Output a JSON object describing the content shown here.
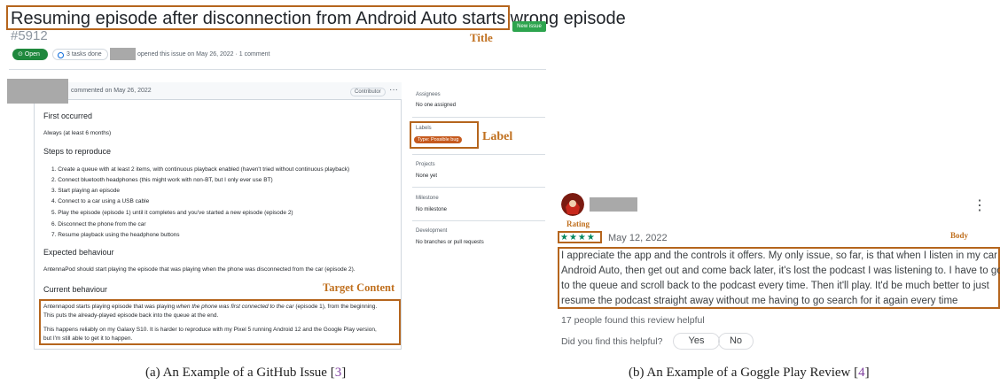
{
  "annotations": {
    "title": "Title",
    "label": "Label",
    "target_content": "Target Content",
    "rating": "Rating",
    "body": "Body"
  },
  "github": {
    "title": "Resuming episode after disconnection from Android Auto starts wrong episode",
    "new_issue": "New issue",
    "issue_number": "#5912",
    "status": "Open",
    "tasks": "3 tasks done",
    "opened_text": "opened this issue on May 26, 2022 · 1 comment",
    "comment": {
      "header_text": "commented on May 26, 2022",
      "role": "Contributor",
      "more": "···",
      "sections": [
        {
          "heading": "First occurred",
          "text": "Always (at least 6 months)"
        },
        {
          "heading": "Steps to reproduce"
        },
        {
          "heading": "Expected behaviour",
          "text": "AntennaPod should start playing the episode that was playing when the phone was disconnected from the car (episode 2)."
        },
        {
          "heading": "Current behaviour"
        }
      ],
      "steps": [
        "1. Create a queue with at least 2 items, with continuous playback enabled (haven't tried without continuous playback)",
        "2. Connect bluetooth headphones (this might work with non-BT, but I only ever use BT)",
        "3. Start playing an episode",
        "4. Connect to a car using a USB cable",
        "5. Play the episode (episode 1) until it completes and you've started a new episode (episode 2)",
        "6. Disconnect the phone from the car",
        "7. Resume playback using the headphone buttons"
      ],
      "current_p1_a": "Antennapod starts playing episode that was playing ",
      "current_p1_em": "when the phone was first connected to the car",
      "current_p1_b": " (episode 1), from the beginning.",
      "current_p1_c": "This puts the already-played episode back into the queue at the end.",
      "current_p2_a": "This happens reliably on my Galaxy S10. It is harder to reproduce with my Pixel 5 running Android 12 and the Google Play version,",
      "current_p2_b": "but I'm still able to get it to happen."
    },
    "sidebar": {
      "assignees_label": "Assignees",
      "assignees_value": "No one assigned",
      "labels_label": "Labels",
      "label_pill": "Type: Possible bug",
      "projects_label": "Projects",
      "projects_value": "None yet",
      "milestone_label": "Milestone",
      "milestone_value": "No milestone",
      "development_label": "Development",
      "development_value": "No branches or pull requests"
    },
    "caption_a": "(a) An Example of a GitHub Issue [",
    "caption_ref": "3",
    "caption_b": "]"
  },
  "play": {
    "date": "May 12, 2022",
    "stars": "★★★★",
    "more": "⋮",
    "review_lines": [
      "I appreciate the app and the controls it offers. My only issue, so far, is that when I listen in my car on",
      "Android Auto, then get out and come back later, it's lost the podcast I was listening to. I have to go",
      "to the queue and scroll back to the podcast every time. Then it'll play. It'd be much better to just",
      "resume the podcast straight away without me having to go search for it again every time"
    ],
    "helpful_count": "17 people found this review helpful",
    "helpful_question": "Did you find this helpful?",
    "yes": "Yes",
    "no": "No",
    "caption_a": "(b) An Example of a Goggle Play Review [",
    "caption_ref": "4",
    "caption_b": "]"
  },
  "colors": {
    "annotation": "#b5651d",
    "open_green": "#1f883d",
    "play_green": "#01875f",
    "label_orange": "#c65a1e"
  }
}
